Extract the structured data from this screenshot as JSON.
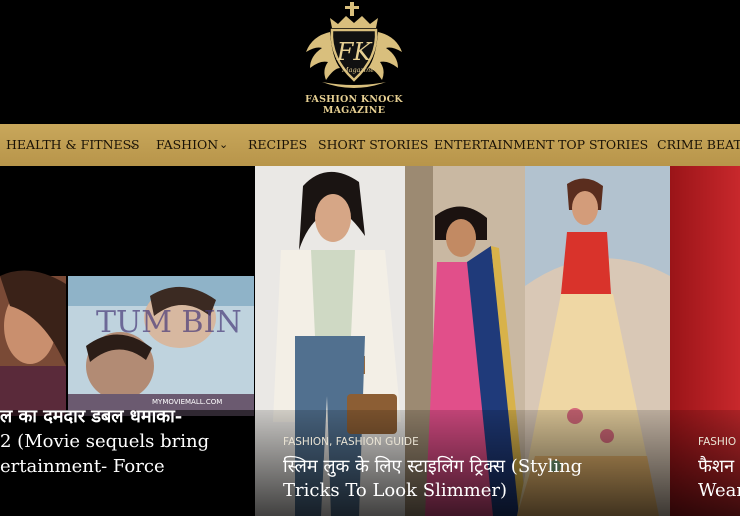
{
  "logo": {
    "monogram": "FK",
    "sub": "Magazine",
    "line1": "FASHION KNOCK",
    "line2": "MAGAZINE",
    "color": "#e6cf92"
  },
  "nav": {
    "items": [
      {
        "label": "HEALTH & FITNESS",
        "chevron": "⌄"
      },
      {
        "label": "FASHION",
        "chevron": "⌄"
      },
      {
        "label": "RECIPES"
      },
      {
        "label": "SHORT STORIES"
      },
      {
        "label": "ENTERTAINMENT"
      },
      {
        "label": "TOP STORIES"
      },
      {
        "label": "CRIME BEAT"
      }
    ],
    "bar_color": "#c09e52"
  },
  "slides": [
    {
      "poster_word": "TUM BIN",
      "poster_site": "MYMOVIEMALL.COM",
      "title_line1": "ल का दमदार डबल धमाका-",
      "title_line2": "2 (Movie sequels bring",
      "title_line3": "ertainment- Force"
    },
    {
      "categories": "FASHION, FASHION GUIDE",
      "title_line1": "स्लिम लुक के लिए स्टाइलिंग ट्रिक्स (Styling",
      "title_line2": "Tricks To Look Slimmer)"
    },
    {
      "categories": "FASHIO",
      "title_line1": "फैशन",
      "title_line2": "Wear"
    }
  ]
}
